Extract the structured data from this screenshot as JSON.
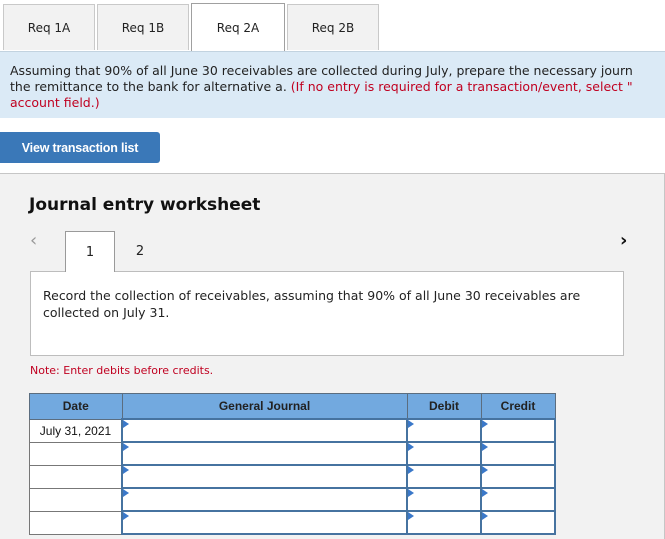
{
  "tabs": [
    {
      "label": "Req 1A",
      "active": false
    },
    {
      "label": "Req 1B",
      "active": false
    },
    {
      "label": "Req 2A",
      "active": true
    },
    {
      "label": "Req 2B",
      "active": false
    }
  ],
  "instructions": {
    "main": "Assuming that 90% of all June 30 receivables are collected during July, prepare the necessary journ",
    "main_line2": "the remittance to the bank for alternative a.",
    "red_line2": " (If no entry is required for a transaction/event, select \"",
    "red_line3": "account field.)"
  },
  "view_button": "View transaction list",
  "worksheet": {
    "title": "Journal entry worksheet",
    "prev_icon": "chevron-left-icon",
    "next_icon": "chevron-right-icon",
    "entry_tabs": [
      "1",
      "2"
    ],
    "active_entry": "1",
    "description": "Record the collection of receivables, assuming that 90% of all June 30 receivables are collected on July 31.",
    "note": "Note: Enter debits before credits."
  },
  "journal": {
    "headers": {
      "date": "Date",
      "general_journal": "General Journal",
      "debit": "Debit",
      "credit": "Credit"
    },
    "rows": [
      {
        "date": "July 31, 2021",
        "account": "",
        "debit": "",
        "credit": ""
      },
      {
        "date": "",
        "account": "",
        "debit": "",
        "credit": ""
      },
      {
        "date": "",
        "account": "",
        "debit": "",
        "credit": ""
      },
      {
        "date": "",
        "account": "",
        "debit": "",
        "credit": ""
      },
      {
        "date": "",
        "account": "",
        "debit": "",
        "credit": ""
      }
    ]
  }
}
